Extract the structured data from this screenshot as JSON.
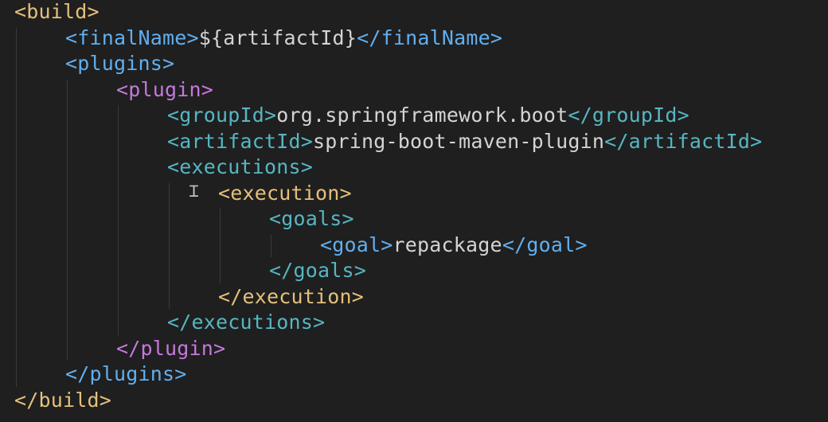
{
  "colors": {
    "background": "#1f1f1f",
    "level0": "#e5c07b",
    "level1": "#61afef",
    "level2": "#c678dd",
    "level3": "#56b6c2",
    "level4": "#e5c07b",
    "text": "#d4d4d4"
  },
  "icons": {
    "cursor": "text-cursor-icon"
  },
  "lines": [
    {
      "indent": 0,
      "level": "level0",
      "open": "<",
      "tag": "build",
      "close": ">",
      "content": "",
      "endOpen": "",
      "endTag": "",
      "endClose": ""
    },
    {
      "indent": 1,
      "level": "level1",
      "open": "<",
      "tag": "finalName",
      "close": ">",
      "content": "${artifactId}",
      "endOpen": "</",
      "endTag": "finalName",
      "endClose": ">"
    },
    {
      "indent": 1,
      "level": "level1",
      "open": "<",
      "tag": "plugins",
      "close": ">",
      "content": "",
      "endOpen": "",
      "endTag": "",
      "endClose": ""
    },
    {
      "indent": 2,
      "level": "level2",
      "open": "<",
      "tag": "plugin",
      "close": ">",
      "content": "",
      "endOpen": "",
      "endTag": "",
      "endClose": ""
    },
    {
      "indent": 3,
      "level": "level3",
      "open": "<",
      "tag": "groupId",
      "close": ">",
      "content": "org.springframework.boot",
      "endOpen": "</",
      "endTag": "groupId",
      "endClose": ">"
    },
    {
      "indent": 3,
      "level": "level3",
      "open": "<",
      "tag": "artifactId",
      "close": ">",
      "content": "spring-boot-maven-plugin",
      "endOpen": "</",
      "endTag": "artifactId",
      "endClose": ">"
    },
    {
      "indent": 3,
      "level": "level3",
      "open": "<",
      "tag": "executions",
      "close": ">",
      "content": "",
      "endOpen": "",
      "endTag": "",
      "endClose": ""
    },
    {
      "indent": 4,
      "level": "level4",
      "open": "<",
      "tag": "execution",
      "close": ">",
      "content": "",
      "endOpen": "",
      "endTag": "",
      "endClose": ""
    },
    {
      "indent": 5,
      "level": "level3",
      "open": "<",
      "tag": "goals",
      "close": ">",
      "content": "",
      "endOpen": "",
      "endTag": "",
      "endClose": ""
    },
    {
      "indent": 6,
      "level": "level1",
      "open": "<",
      "tag": "goal",
      "close": ">",
      "content": "repackage",
      "endOpen": "</",
      "endTag": "goal",
      "endClose": ">"
    },
    {
      "indent": 5,
      "level": "level3",
      "open": "</",
      "tag": "goals",
      "close": ">",
      "content": "",
      "endOpen": "",
      "endTag": "",
      "endClose": ""
    },
    {
      "indent": 4,
      "level": "level4",
      "open": "</",
      "tag": "execution",
      "close": ">",
      "content": "",
      "endOpen": "",
      "endTag": "",
      "endClose": ""
    },
    {
      "indent": 3,
      "level": "level3",
      "open": "</",
      "tag": "executions",
      "close": ">",
      "content": "",
      "endOpen": "",
      "endTag": "",
      "endClose": ""
    },
    {
      "indent": 2,
      "level": "level2",
      "open": "</",
      "tag": "plugin",
      "close": ">",
      "content": "",
      "endOpen": "",
      "endTag": "",
      "endClose": ""
    },
    {
      "indent": 1,
      "level": "level1",
      "open": "</",
      "tag": "plugins",
      "close": ">",
      "content": "",
      "endOpen": "",
      "endTag": "",
      "endClose": ""
    },
    {
      "indent": 0,
      "level": "level0",
      "open": "</",
      "tag": "build",
      "close": ">",
      "content": "",
      "endOpen": "",
      "endTag": "",
      "endClose": ""
    }
  ]
}
